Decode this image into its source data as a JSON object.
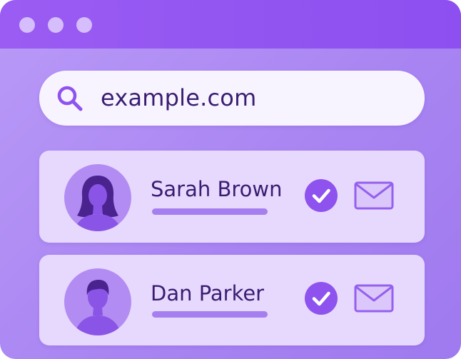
{
  "window": {
    "controls": [
      "window-dot",
      "window-dot",
      "window-dot"
    ]
  },
  "search": {
    "icon": "search-icon",
    "value": "example.com"
  },
  "contacts": [
    {
      "name": "Sarah Brown",
      "avatar_icon": "female-avatar-icon",
      "status_icon": "checkmark-icon",
      "action_icon": "mail-icon"
    },
    {
      "name": "Dan Parker",
      "avatar_icon": "male-avatar-icon",
      "status_icon": "checkmark-icon",
      "action_icon": "mail-icon"
    }
  ],
  "colors": {
    "titlebar": "#8d4ff0",
    "background": "#a985f2",
    "card": "#e7d9fd",
    "accent": "#8e52ee",
    "text": "#3a1d72"
  }
}
